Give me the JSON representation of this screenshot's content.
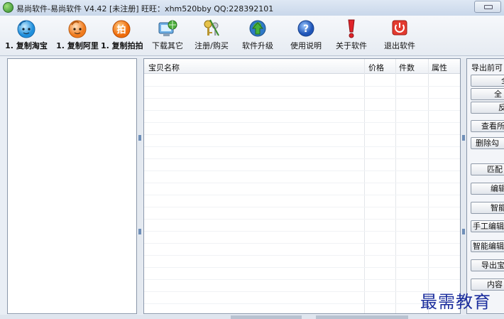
{
  "window": {
    "title": "易尚软件-易尚软件 V4.42 [未注册] 旺旺：xhm520bby  QQ:228392101"
  },
  "toolbar": {
    "items": [
      {
        "label": "1. 复制淘宝",
        "icon": "taobao-icon"
      },
      {
        "label": "1. 复制阿里",
        "icon": "alibaba-icon"
      },
      {
        "label": "1. 复制拍拍",
        "icon": "paipai-icon"
      },
      {
        "label": "下载其它",
        "icon": "computer-globe-icon"
      },
      {
        "label": "注册/购买",
        "icon": "keys-icon"
      },
      {
        "label": "软件升级",
        "icon": "upgrade-arrow-icon"
      },
      {
        "label": "使用说明",
        "icon": "help-icon"
      },
      {
        "label": "关于软件",
        "icon": "exclamation-icon"
      },
      {
        "label": "退出软件",
        "icon": "power-icon"
      }
    ]
  },
  "table": {
    "columns": [
      "宝贝名称",
      "价格",
      "件数",
      "属性"
    ],
    "rows": []
  },
  "right_panel": {
    "title": "导出前可",
    "buttons": [
      "全",
      "全",
      "反",
      "查看所",
      "删除勾",
      "匹配",
      "编辑",
      "智能",
      "手工编辑",
      "智能编辑",
      "导出宝",
      "内容"
    ]
  },
  "watermark": "最需教育",
  "colors": {
    "accent": "#1d2f9e",
    "titlebar": "#c9d7ea",
    "border": "#8a97aa"
  }
}
